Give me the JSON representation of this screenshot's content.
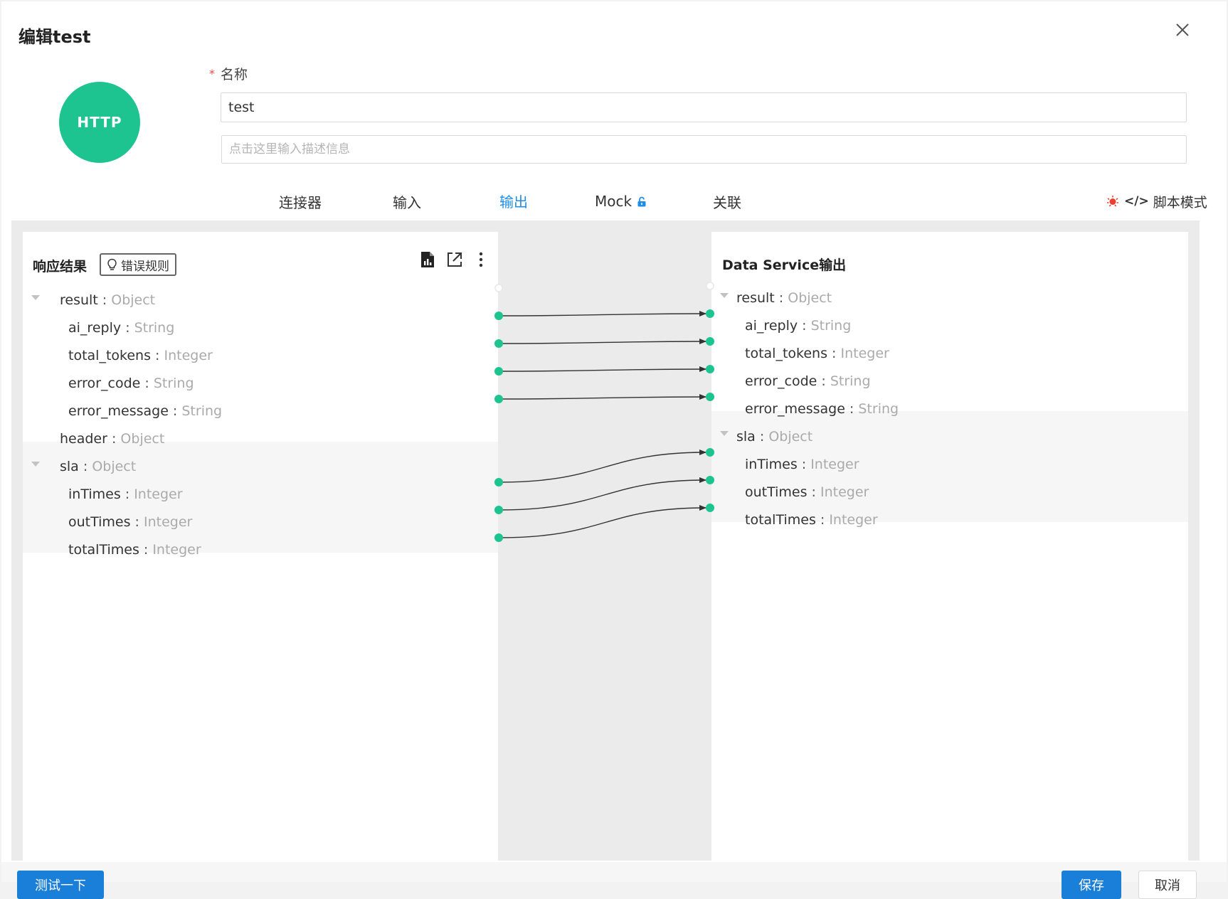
{
  "dialog": {
    "title": "编辑test"
  },
  "logo": {
    "text": "HTTP",
    "color": "#1dc490"
  },
  "form": {
    "required_mark": "*",
    "name_label": "名称",
    "name_value": "test",
    "desc_placeholder": "点击这里输入描述信息"
  },
  "tabs": [
    {
      "label": "连接器",
      "active": false
    },
    {
      "label": "输入",
      "active": false
    },
    {
      "label": "输出",
      "active": true
    },
    {
      "label": "Mock",
      "active": false
    },
    {
      "label": "关联",
      "active": false
    }
  ],
  "script_mode": {
    "label": "脚本模式"
  },
  "left_panel": {
    "title": "响应结果",
    "error_rule_label": "错误规则",
    "fields": [
      {
        "name": "result",
        "sep": " : ",
        "type": "Object"
      },
      {
        "name": "ai_reply",
        "sep": " : ",
        "type": "String"
      },
      {
        "name": "total_tokens",
        "sep": " : ",
        "type": "Integer"
      },
      {
        "name": "error_code",
        "sep": " : ",
        "type": "String"
      },
      {
        "name": "error_message",
        "sep": " : ",
        "type": "String"
      },
      {
        "name": "header",
        "sep": " : ",
        "type": "Object"
      },
      {
        "name": "sla",
        "sep": " : ",
        "type": "Object"
      },
      {
        "name": "inTimes",
        "sep": " : ",
        "type": "Integer"
      },
      {
        "name": "outTimes",
        "sep": " : ",
        "type": "Integer"
      },
      {
        "name": "totalTimes",
        "sep": " : ",
        "type": "Integer"
      }
    ]
  },
  "right_panel": {
    "title": "Data Service输出",
    "fields": [
      {
        "name": "result",
        "sep": " : ",
        "type": "Object"
      },
      {
        "name": "ai_reply",
        "sep": " : ",
        "type": "String"
      },
      {
        "name": "total_tokens",
        "sep": " : ",
        "type": "Integer"
      },
      {
        "name": "error_code",
        "sep": " : ",
        "type": "String"
      },
      {
        "name": "error_message",
        "sep": " : ",
        "type": "String"
      },
      {
        "name": "sla",
        "sep": " : ",
        "type": "Object"
      },
      {
        "name": "inTimes",
        "sep": " : ",
        "type": "Integer"
      },
      {
        "name": "outTimes",
        "sep": " : ",
        "type": "Integer"
      },
      {
        "name": "totalTimes",
        "sep": " : ",
        "type": "Integer"
      }
    ]
  },
  "mappings": [
    {
      "from": "ai_reply",
      "to": "ai_reply"
    },
    {
      "from": "total_tokens",
      "to": "total_tokens"
    },
    {
      "from": "error_code",
      "to": "error_code"
    },
    {
      "from": "error_message",
      "to": "error_message"
    },
    {
      "from": "inTimes",
      "to": "inTimes"
    },
    {
      "from": "outTimes",
      "to": "outTimes"
    },
    {
      "from": "totalTimes",
      "to": "totalTimes"
    }
  ],
  "footer": {
    "test_label": "测试一下",
    "save_label": "保存",
    "cancel_label": "取消"
  },
  "colors": {
    "accent": "#1e8ee6",
    "connector": "#1dc490",
    "primary_button": "#1a7fd8"
  }
}
